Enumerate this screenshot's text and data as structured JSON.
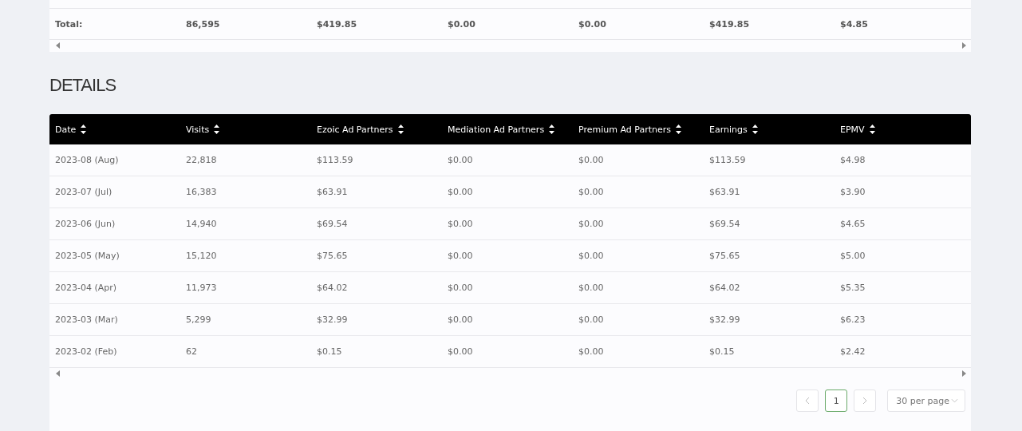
{
  "summary": {
    "total_row": [
      "Total:",
      "86,595",
      "$419.85",
      "$0.00",
      "$0.00",
      "$419.85",
      "$4.85"
    ]
  },
  "details": {
    "title": "DETAILS",
    "columns": [
      "Date",
      "Visits",
      "Ezoic Ad Partners",
      "Mediation Ad Partners",
      "Premium Ad Partners",
      "Earnings",
      "EPMV"
    ],
    "rows": [
      [
        "2023-08 (Aug)",
        "22,818",
        "$113.59",
        "$0.00",
        "$0.00",
        "$113.59",
        "$4.98"
      ],
      [
        "2023-07 (Jul)",
        "16,383",
        "$63.91",
        "$0.00",
        "$0.00",
        "$63.91",
        "$3.90"
      ],
      [
        "2023-06 (Jun)",
        "14,940",
        "$69.54",
        "$0.00",
        "$0.00",
        "$69.54",
        "$4.65"
      ],
      [
        "2023-05 (May)",
        "15,120",
        "$75.65",
        "$0.00",
        "$0.00",
        "$75.65",
        "$5.00"
      ],
      [
        "2023-04 (Apr)",
        "11,973",
        "$64.02",
        "$0.00",
        "$0.00",
        "$64.02",
        "$5.35"
      ],
      [
        "2023-03 (Mar)",
        "5,299",
        "$32.99",
        "$0.00",
        "$0.00",
        "$32.99",
        "$6.23"
      ],
      [
        "2023-02 (Feb)",
        "62",
        "$0.15",
        "$0.00",
        "$0.00",
        "$0.15",
        "$2.42"
      ]
    ],
    "pagination": {
      "pages": [
        {
          "label": "1",
          "selected": true
        }
      ],
      "per_page": "30 per page"
    }
  }
}
